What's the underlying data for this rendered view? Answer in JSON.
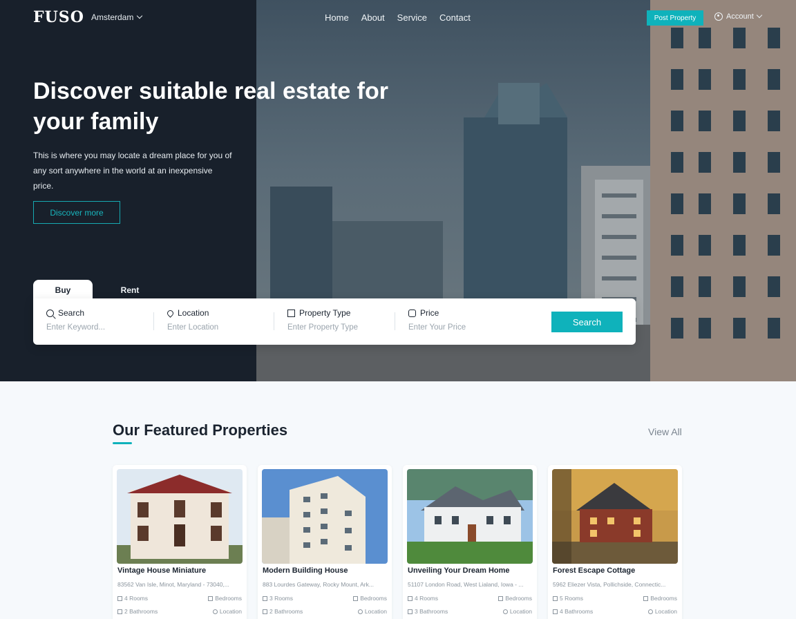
{
  "header": {
    "logo": "FUSO",
    "city": "Amsterdam",
    "nav": [
      "Home",
      "About",
      "Service",
      "Contact"
    ],
    "post_property": "Post Property",
    "account": "Account"
  },
  "hero": {
    "title": "Discover suitable real estate for your family",
    "lead": "This is where you may locate a dream place for you of any sort anywhere in the world at an inexpensive price.",
    "discover_button": "Discover more"
  },
  "search": {
    "tabs": [
      "Buy",
      "Rent"
    ],
    "active_tab": "Buy",
    "fields": [
      {
        "label": "Search",
        "placeholder": "Enter Keyword...",
        "icon": "search-icon"
      },
      {
        "label": "Location",
        "placeholder": "Enter Location",
        "icon": "location-pin-icon"
      },
      {
        "label": "Property Type",
        "placeholder": "Enter Property Type",
        "icon": "building-icon"
      },
      {
        "label": "Price",
        "placeholder": "Enter Your Price",
        "icon": "price-tag-icon"
      }
    ],
    "button": "Search"
  },
  "featured": {
    "title": "Our Featured Properties",
    "view_all": "View All",
    "cards": [
      {
        "name": "Vintage House Miniature",
        "address": "83562 Van Isle, Minot, Maryland - 73040,...",
        "rooms": "4 Rooms",
        "bedrooms": "Bedrooms",
        "bathrooms": "2 Bathrooms",
        "location": "Location"
      },
      {
        "name": "Modern Building House",
        "address": "883 Lourdes Gateway, Rocky Mount, Ark...",
        "rooms": "3 Rooms",
        "bedrooms": "Bedrooms",
        "bathrooms": "2 Bathrooms",
        "location": "Location"
      },
      {
        "name": "Unveiling Your Dream Home",
        "address": "51107 London Road, West Lialand, Iowa - ...",
        "rooms": "4 Rooms",
        "bedrooms": "Bedrooms",
        "bathrooms": "3 Bathrooms",
        "location": "Location"
      },
      {
        "name": "Forest Escape Cottage",
        "address": "5962 Eliezer Vista, Pollichside, Connectic...",
        "rooms": "5 Rooms",
        "bedrooms": "Bedrooms",
        "bathrooms": "4 Bathrooms",
        "location": "Location"
      }
    ]
  },
  "colors": {
    "accent": "#0fb2bb",
    "dark": "#18202b"
  }
}
